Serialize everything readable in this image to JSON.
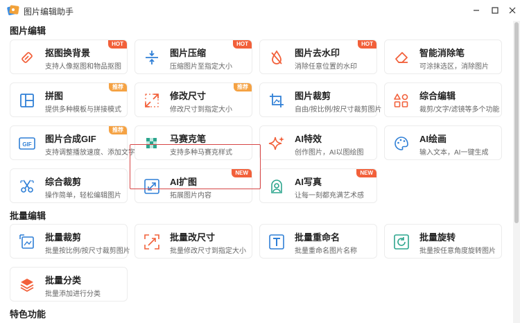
{
  "app": {
    "title": "图片编辑助手"
  },
  "window_controls": [
    "最小化",
    "最大化",
    "关闭"
  ],
  "sections": {
    "image_edit": {
      "title": "图片编辑"
    },
    "batch_edit": {
      "title": "批量编辑"
    },
    "feature": {
      "title": "特色功能"
    }
  },
  "cards": {
    "cutout": {
      "title": "抠图换背景",
      "desc": "支持人像抠图和物品抠图",
      "badge": "HOT",
      "icon": "eraser-brush-icon"
    },
    "compress": {
      "title": "图片压缩",
      "desc": "压缩图片至指定大小",
      "badge": "HOT",
      "icon": "compress-arrows-icon"
    },
    "watermark": {
      "title": "图片去水印",
      "desc": "消除任意位置的水印",
      "badge": "HOT",
      "icon": "water-drop-slash-icon"
    },
    "smart_erase": {
      "title": "智能消除笔",
      "desc": "可涂抹选区，消除图片",
      "icon": "eraser-icon"
    },
    "collage": {
      "title": "拼图",
      "desc": "提供多种模板与拼接模式",
      "badge": "推荐",
      "icon": "layout-grid-icon"
    },
    "resize": {
      "title": "修改尺寸",
      "desc": "修改尺寸到指定大小",
      "badge": "推荐",
      "icon": "expand-arrows-icon"
    },
    "crop": {
      "title": "图片裁剪",
      "desc": "自由/按比例/按尺寸裁剪图片",
      "icon": "crop-icon"
    },
    "combo_edit": {
      "title": "综合编辑",
      "desc": "裁剪/文字/滤镜等多个功能",
      "icon": "shapes-icon"
    },
    "gif": {
      "title": "图片合成GIF",
      "desc": "支持调整播放速度、添加文字",
      "badge": "推荐",
      "icon": "gif-icon"
    },
    "mosaic": {
      "title": "马赛克笔",
      "desc": "支持多种马赛克样式",
      "icon": "mosaic-icon"
    },
    "ai_effect": {
      "title": "AI特效",
      "desc": "创作图片，AI以图绘图",
      "icon": "sparkle-icon"
    },
    "ai_paint": {
      "title": "AI绘画",
      "desc": "输入文本，AI一键生成",
      "icon": "palette-icon"
    },
    "combo_crop": {
      "title": "综合裁剪",
      "desc": "操作简单，轻松编辑图片",
      "icon": "scissors-icon"
    },
    "ai_expand": {
      "title": "AI扩图",
      "desc": "拓展图片内容",
      "badge": "NEW",
      "icon": "expand-diagonal-icon"
    },
    "ai_portrait": {
      "title": "AI写真",
      "desc": "让每一刻都充满艺术感",
      "badge": "NEW",
      "icon": "portrait-frame-icon"
    },
    "batch_crop": {
      "title": "批量裁剪",
      "desc": "批量按比例/按尺寸裁剪图片",
      "icon": "batch-crop-icon"
    },
    "batch_resize": {
      "title": "批量改尺寸",
      "desc": "批量修改尺寸到指定大小",
      "icon": "batch-resize-icon"
    },
    "batch_rename": {
      "title": "批量重命名",
      "desc": "批量重命名图片名称",
      "icon": "rename-icon"
    },
    "batch_rotate": {
      "title": "批量旋转",
      "desc": "批量按任意角度旋转图片",
      "icon": "rotate-icon"
    },
    "batch_classify": {
      "title": "批量分类",
      "desc": "批量添加进行分类",
      "icon": "layers-icon"
    }
  },
  "colors": {
    "accent_blue": "#2f7fd6",
    "accent_orange": "#f2603a",
    "badge_recommend": "#f5a243",
    "highlight_red": "#d64545"
  }
}
